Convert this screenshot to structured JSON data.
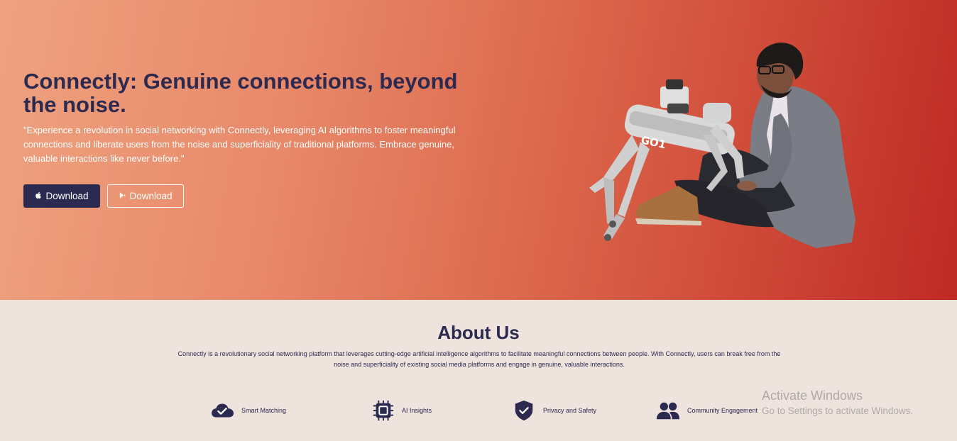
{
  "hero": {
    "title": "Connectly: Genuine connections, beyond the noise.",
    "description": "\"Experience a revolution in social networking with Connectly, leveraging AI algorithms to foster meaningful connections and liberate users from the noise and superficiality of traditional platforms. Embrace genuine, valuable interactions like never before.\"",
    "buttons": [
      {
        "label": "Download",
        "icon": "apple-icon"
      },
      {
        "label": "Download",
        "icon": "google-play-icon"
      }
    ],
    "colors": {
      "gradient_start": "#eea27f",
      "gradient_end": "#be2a24",
      "heading": "#2c2a4f",
      "button_primary": "#2b2a50"
    }
  },
  "about": {
    "title": "About Us",
    "description": "Connectly is a revolutionary social networking platform that leverages cutting-edge artificial intelligence algorithms to facilitate meaningful connections between people. With Connectly, users can break free from the noise and superficiality of existing social media platforms and engage in genuine, valuable interactions.",
    "features": [
      {
        "label": "Smart Matching",
        "icon": "cloud-check-icon"
      },
      {
        "label": "AI Insights",
        "icon": "chip-icon"
      },
      {
        "label": "Privacy and Safety",
        "icon": "shield-check-icon"
      },
      {
        "label": "Community Engagement",
        "icon": "users-icon"
      }
    ]
  },
  "watermark": {
    "line1": "Activate Windows",
    "line2": "Go to Settings to activate Windows."
  }
}
